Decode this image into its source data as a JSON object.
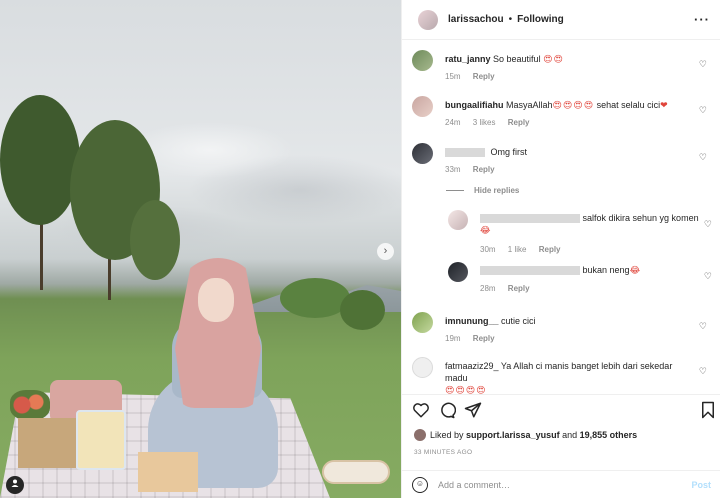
{
  "header": {
    "username": "larissachou",
    "separator": "•",
    "follow_status": "Following",
    "more_icon": "more-icon"
  },
  "photo": {
    "next_icon": "chevron-right-icon",
    "tag_icon": "user-tag-icon"
  },
  "comments": [
    {
      "user": "ratu_janny",
      "text": "So beautiful",
      "emoji": "😍😍",
      "time": "15m",
      "likes": "",
      "reply": "Reply"
    },
    {
      "user": "bungaalifiahu",
      "text": "MasyaAllah",
      "emoji": "😍😍😍😍",
      "text2": "sehat selalu cici",
      "emoji2": "❤",
      "time": "24m",
      "likes": "3 likes",
      "reply": "Reply"
    },
    {
      "user": "",
      "text": "Omg first",
      "time": "33m",
      "reply": "Reply"
    },
    {
      "user": "imnunung__",
      "text": "cutie cici",
      "time": "19m",
      "reply": "Reply"
    },
    {
      "user": "fatmaaziz29_",
      "text": "Ya Allah ci manis banget lebih dari sekedar madu",
      "emoji": "😍😍😍😍",
      "time": "",
      "reply": ""
    }
  ],
  "hide_replies": "Hide replies",
  "replies": [
    {
      "text": "salfok dikira sehun yg komen",
      "emoji": "😂",
      "time": "30m",
      "likes": "1 like",
      "reply": "Reply"
    },
    {
      "text": "bukan neng",
      "emoji": "😂",
      "time": "28m",
      "reply": "Reply"
    }
  ],
  "footer": {
    "liked_prefix": "Liked by",
    "liked_user": "support.larissa_yusuf",
    "liked_and": "and",
    "liked_others": "19,855 others",
    "timestamp": "33 MINUTES AGO",
    "comment_placeholder": "Add a comment…",
    "post_label": "Post"
  },
  "colors": {
    "link": "#0095f6",
    "post_disabled": "#b2dffc",
    "heart_red": "#ed4956"
  }
}
